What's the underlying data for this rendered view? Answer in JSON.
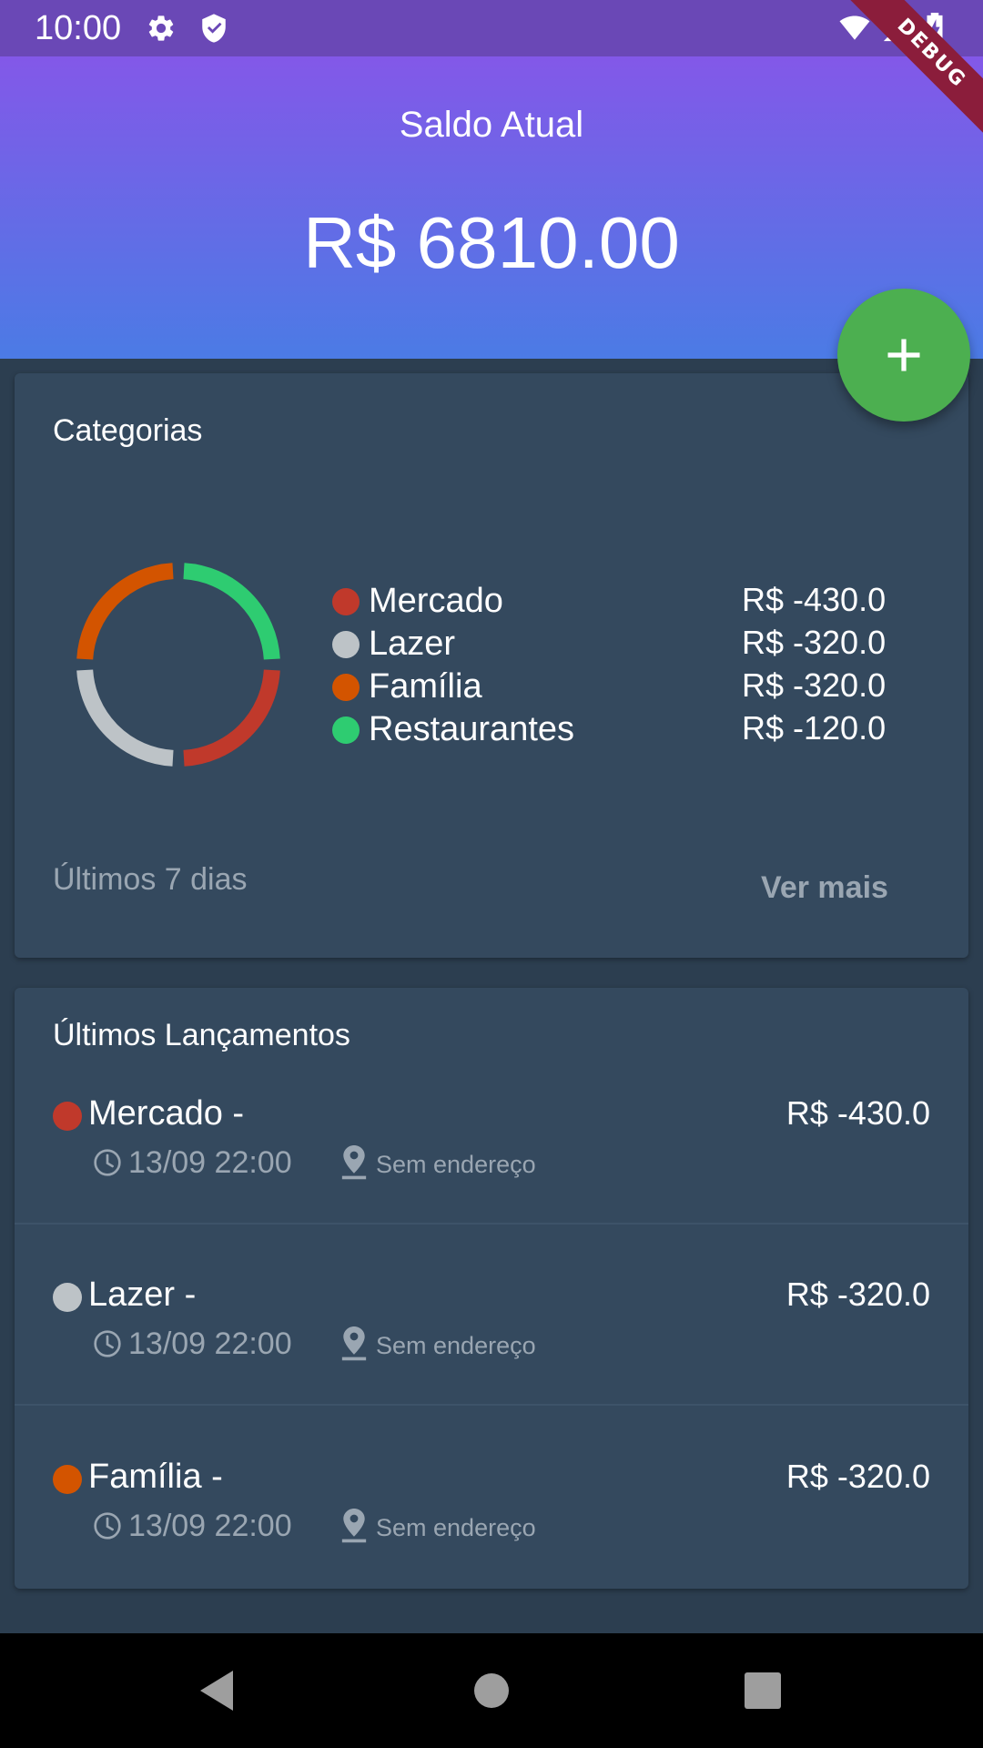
{
  "status_bar": {
    "time": "10:00",
    "icons": [
      "settings-icon",
      "shield-icon",
      "wifi-icon",
      "signal-icon",
      "battery-charging-icon"
    ]
  },
  "debug_banner": "DEBUG",
  "header": {
    "label": "Saldo Atual",
    "balance": "R$ 6810.00"
  },
  "fab": {
    "icon": "plus-icon",
    "color": "#4caf50"
  },
  "categories_card": {
    "title": "Categorias",
    "period": "Últimos 7 dias",
    "more_label": "Ver mais",
    "items": [
      {
        "name": "Mercado",
        "value": "R$ -430.0",
        "color": "#c0392b"
      },
      {
        "name": "Lazer",
        "value": "R$ -320.0",
        "color": "#bdc3c7"
      },
      {
        "name": "Família",
        "value": "R$ -320.0",
        "color": "#d35400"
      },
      {
        "name": "Restaurantes",
        "value": "R$ -120.0",
        "color": "#2ecc71"
      }
    ]
  },
  "entries_card": {
    "title": "Últimos Lançamentos",
    "entries": [
      {
        "title": "Mercado -",
        "amount": "R$ -430.0",
        "date": "13/09 22:00",
        "address": "Sem endereço",
        "color": "#c0392b"
      },
      {
        "title": "Lazer -",
        "amount": "R$ -320.0",
        "date": "13/09 22:00",
        "address": "Sem endereço",
        "color": "#bdc3c7"
      },
      {
        "title": "Família -",
        "amount": "R$ -320.0",
        "date": "13/09 22:00",
        "address": "Sem endereço",
        "color": "#d35400"
      }
    ]
  },
  "colors": {
    "background": "#2c3e50",
    "card": "#34495e",
    "header_top": "#8358e8",
    "header_bottom": "#4b7be5",
    "status_bar": "#6a48b6",
    "muted_text": "#9aa6b2"
  },
  "nav": {
    "icons": [
      "back-icon",
      "home-icon",
      "recents-icon"
    ]
  }
}
